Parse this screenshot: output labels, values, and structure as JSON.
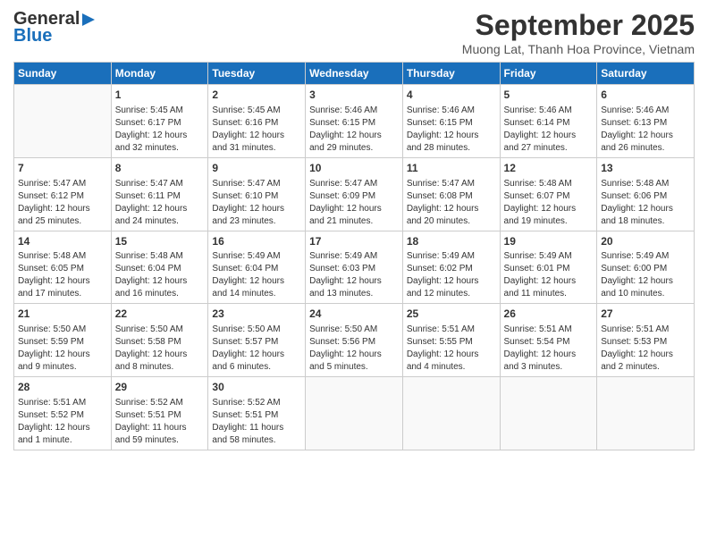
{
  "header": {
    "logo_general": "General",
    "logo_blue": "Blue",
    "month_title": "September 2025",
    "location": "Muong Lat, Thanh Hoa Province, Vietnam"
  },
  "days_of_week": [
    "Sunday",
    "Monday",
    "Tuesday",
    "Wednesday",
    "Thursday",
    "Friday",
    "Saturday"
  ],
  "weeks": [
    [
      {
        "day": "",
        "info": ""
      },
      {
        "day": "1",
        "info": "Sunrise: 5:45 AM\nSunset: 6:17 PM\nDaylight: 12 hours\nand 32 minutes."
      },
      {
        "day": "2",
        "info": "Sunrise: 5:45 AM\nSunset: 6:16 PM\nDaylight: 12 hours\nand 31 minutes."
      },
      {
        "day": "3",
        "info": "Sunrise: 5:46 AM\nSunset: 6:15 PM\nDaylight: 12 hours\nand 29 minutes."
      },
      {
        "day": "4",
        "info": "Sunrise: 5:46 AM\nSunset: 6:15 PM\nDaylight: 12 hours\nand 28 minutes."
      },
      {
        "day": "5",
        "info": "Sunrise: 5:46 AM\nSunset: 6:14 PM\nDaylight: 12 hours\nand 27 minutes."
      },
      {
        "day": "6",
        "info": "Sunrise: 5:46 AM\nSunset: 6:13 PM\nDaylight: 12 hours\nand 26 minutes."
      }
    ],
    [
      {
        "day": "7",
        "info": "Sunrise: 5:47 AM\nSunset: 6:12 PM\nDaylight: 12 hours\nand 25 minutes."
      },
      {
        "day": "8",
        "info": "Sunrise: 5:47 AM\nSunset: 6:11 PM\nDaylight: 12 hours\nand 24 minutes."
      },
      {
        "day": "9",
        "info": "Sunrise: 5:47 AM\nSunset: 6:10 PM\nDaylight: 12 hours\nand 23 minutes."
      },
      {
        "day": "10",
        "info": "Sunrise: 5:47 AM\nSunset: 6:09 PM\nDaylight: 12 hours\nand 21 minutes."
      },
      {
        "day": "11",
        "info": "Sunrise: 5:47 AM\nSunset: 6:08 PM\nDaylight: 12 hours\nand 20 minutes."
      },
      {
        "day": "12",
        "info": "Sunrise: 5:48 AM\nSunset: 6:07 PM\nDaylight: 12 hours\nand 19 minutes."
      },
      {
        "day": "13",
        "info": "Sunrise: 5:48 AM\nSunset: 6:06 PM\nDaylight: 12 hours\nand 18 minutes."
      }
    ],
    [
      {
        "day": "14",
        "info": "Sunrise: 5:48 AM\nSunset: 6:05 PM\nDaylight: 12 hours\nand 17 minutes."
      },
      {
        "day": "15",
        "info": "Sunrise: 5:48 AM\nSunset: 6:04 PM\nDaylight: 12 hours\nand 16 minutes."
      },
      {
        "day": "16",
        "info": "Sunrise: 5:49 AM\nSunset: 6:04 PM\nDaylight: 12 hours\nand 14 minutes."
      },
      {
        "day": "17",
        "info": "Sunrise: 5:49 AM\nSunset: 6:03 PM\nDaylight: 12 hours\nand 13 minutes."
      },
      {
        "day": "18",
        "info": "Sunrise: 5:49 AM\nSunset: 6:02 PM\nDaylight: 12 hours\nand 12 minutes."
      },
      {
        "day": "19",
        "info": "Sunrise: 5:49 AM\nSunset: 6:01 PM\nDaylight: 12 hours\nand 11 minutes."
      },
      {
        "day": "20",
        "info": "Sunrise: 5:49 AM\nSunset: 6:00 PM\nDaylight: 12 hours\nand 10 minutes."
      }
    ],
    [
      {
        "day": "21",
        "info": "Sunrise: 5:50 AM\nSunset: 5:59 PM\nDaylight: 12 hours\nand 9 minutes."
      },
      {
        "day": "22",
        "info": "Sunrise: 5:50 AM\nSunset: 5:58 PM\nDaylight: 12 hours\nand 8 minutes."
      },
      {
        "day": "23",
        "info": "Sunrise: 5:50 AM\nSunset: 5:57 PM\nDaylight: 12 hours\nand 6 minutes."
      },
      {
        "day": "24",
        "info": "Sunrise: 5:50 AM\nSunset: 5:56 PM\nDaylight: 12 hours\nand 5 minutes."
      },
      {
        "day": "25",
        "info": "Sunrise: 5:51 AM\nSunset: 5:55 PM\nDaylight: 12 hours\nand 4 minutes."
      },
      {
        "day": "26",
        "info": "Sunrise: 5:51 AM\nSunset: 5:54 PM\nDaylight: 12 hours\nand 3 minutes."
      },
      {
        "day": "27",
        "info": "Sunrise: 5:51 AM\nSunset: 5:53 PM\nDaylight: 12 hours\nand 2 minutes."
      }
    ],
    [
      {
        "day": "28",
        "info": "Sunrise: 5:51 AM\nSunset: 5:52 PM\nDaylight: 12 hours\nand 1 minute."
      },
      {
        "day": "29",
        "info": "Sunrise: 5:52 AM\nSunset: 5:51 PM\nDaylight: 11 hours\nand 59 minutes."
      },
      {
        "day": "30",
        "info": "Sunrise: 5:52 AM\nSunset: 5:51 PM\nDaylight: 11 hours\nand 58 minutes."
      },
      {
        "day": "",
        "info": ""
      },
      {
        "day": "",
        "info": ""
      },
      {
        "day": "",
        "info": ""
      },
      {
        "day": "",
        "info": ""
      }
    ]
  ]
}
